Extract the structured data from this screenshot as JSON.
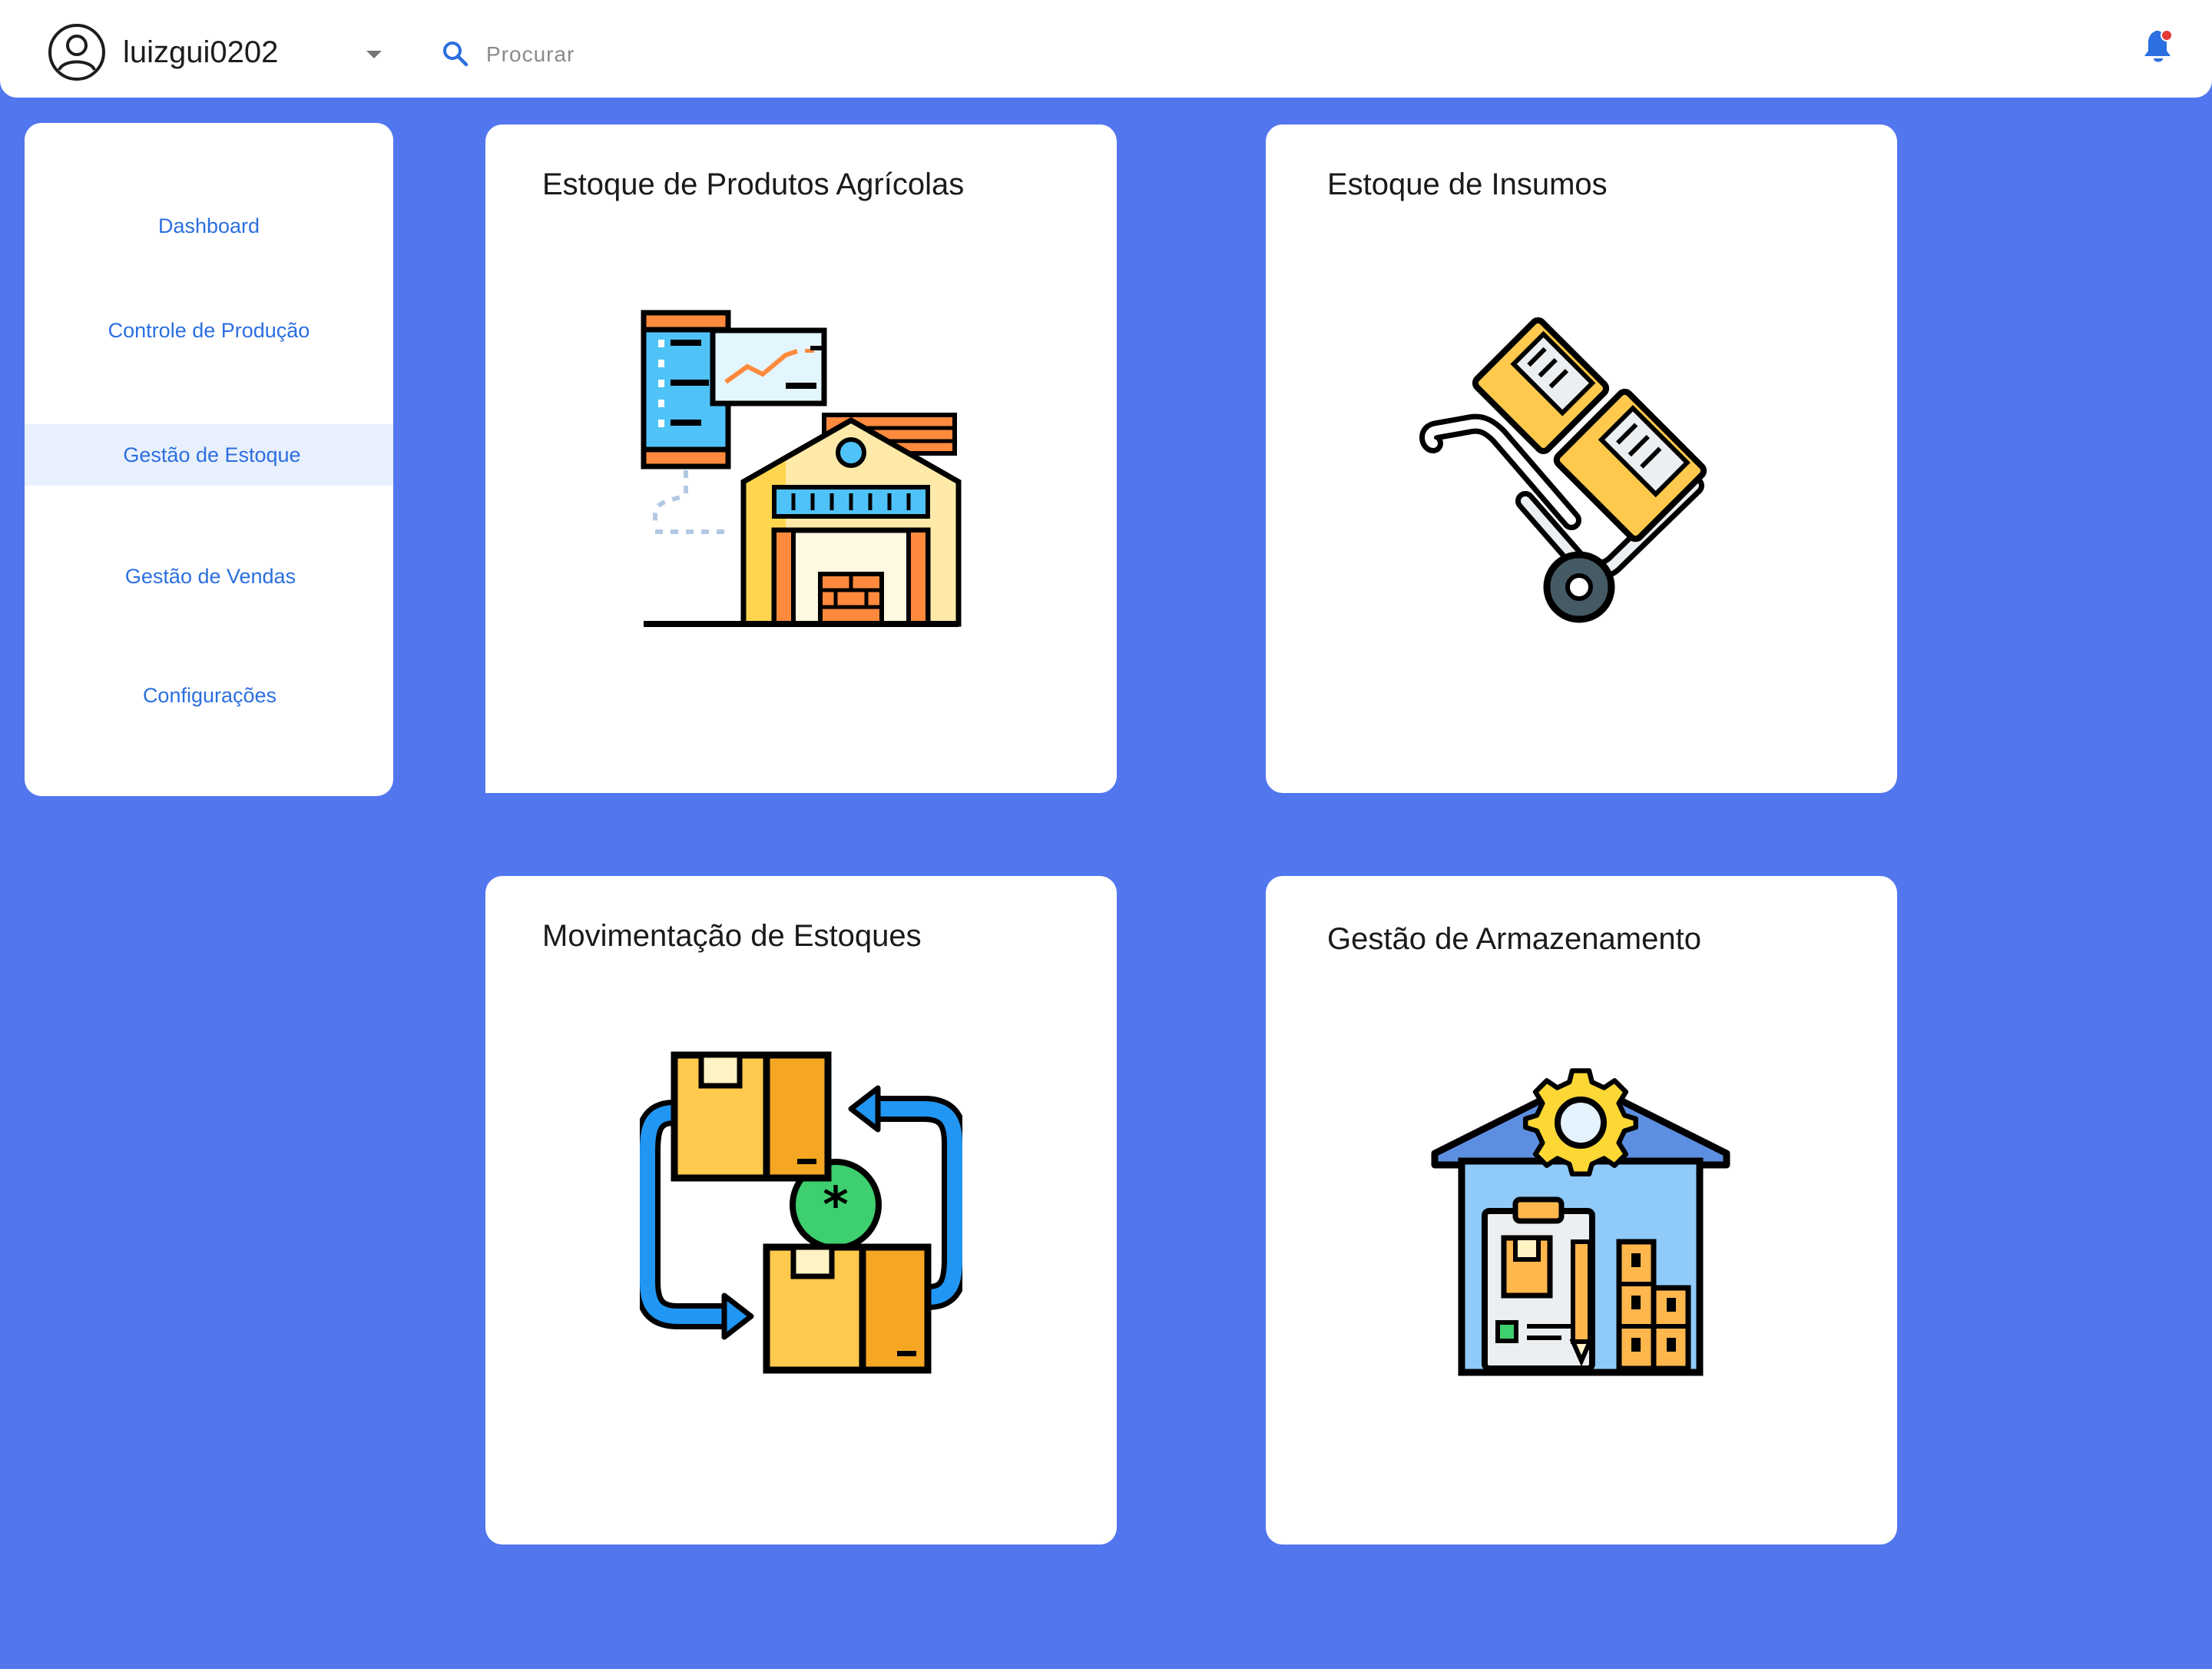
{
  "header": {
    "username": "luizgui0202",
    "search_placeholder": "Procurar",
    "icons": [
      "user-avatar-icon",
      "chevron-down-icon",
      "search-icon",
      "bell-icon"
    ],
    "notification_dot": true
  },
  "sidebar": {
    "items": [
      {
        "label": "Dashboard",
        "active": false
      },
      {
        "label": "Controle de Produção",
        "active": false
      },
      {
        "label": "Gestão de Estoque",
        "active": true
      },
      {
        "label": "Gestão de Vendas",
        "active": false
      },
      {
        "label": "Configurações",
        "active": false
      }
    ]
  },
  "cards": [
    {
      "title": "Estoque de Produtos Agrícolas",
      "icon": "warehouse-analytics-icon"
    },
    {
      "title": "Estoque de Insumos",
      "icon": "hand-truck-boxes-icon"
    },
    {
      "title": "Movimentação de Estoques",
      "icon": "boxes-exchange-icon"
    },
    {
      "title": "Gestão de Armazenamento",
      "icon": "warehouse-gear-icon"
    }
  ],
  "colors": {
    "background": "#5276ee",
    "surface": "#ffffff",
    "accent": "#2b6fe0",
    "active_nav_bg": "#e9f0fd",
    "notification": "#e53935"
  }
}
